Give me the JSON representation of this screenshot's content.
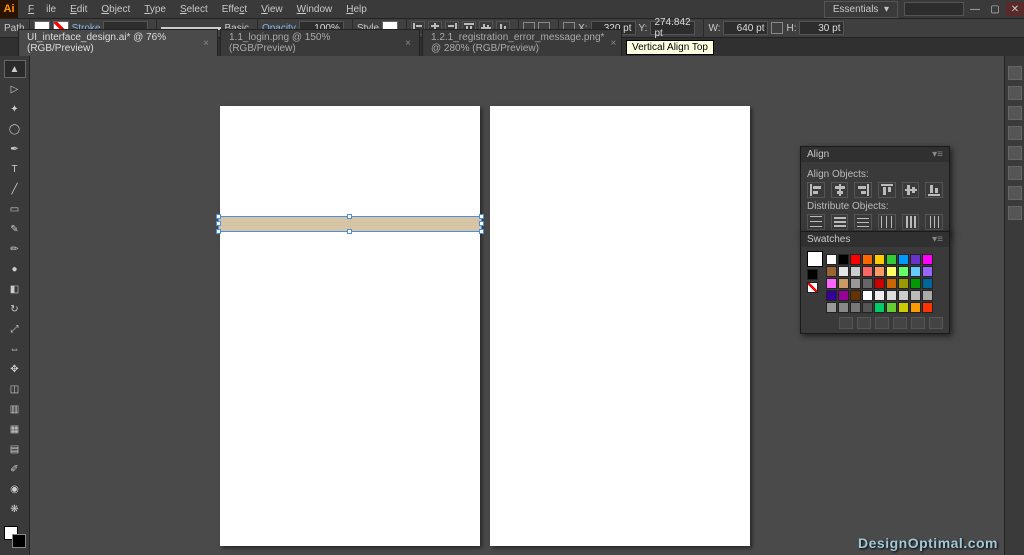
{
  "app": {
    "logo": "Ai",
    "workspace": "Essentials"
  },
  "menu": [
    "File",
    "Edit",
    "Object",
    "Type",
    "Select",
    "Effect",
    "View",
    "Window",
    "Help"
  ],
  "controlbar": {
    "selection": "Path",
    "stroke_label": "Stroke",
    "stroke_weight": "",
    "brush_label": "Basic",
    "opacity_label": "Opacity",
    "opacity_value": "100%",
    "style_label": "Style",
    "x_label": "X:",
    "x_value": "320 pt",
    "y_label": "Y:",
    "y_value": "274.842 pt",
    "w_label": "W:",
    "w_value": "640 pt",
    "h_label": "H:",
    "h_value": "30 pt"
  },
  "tabs": [
    {
      "label": "UI_interface_design.ai* @ 76% (RGB/Preview)",
      "active": true
    },
    {
      "label": "1.1_login.png @ 150% (RGB/Preview)",
      "active": false
    },
    {
      "label": "1.2.1_registration_error_message.png* @ 280% (RGB/Preview)",
      "active": false
    }
  ],
  "tooltip": "Vertical Align Top",
  "panels": {
    "align": {
      "title": "Align",
      "section1": "Align Objects:",
      "section2": "Distribute Objects:"
    },
    "swatches": {
      "title": "Swatches",
      "colors": [
        "#ffffff",
        "#000000",
        "#ff0000",
        "#ff6600",
        "#ffcc00",
        "#33cc33",
        "#0099ff",
        "#6633cc",
        "#ff00ff",
        "#996633",
        "#e6e6e6",
        "#cccccc",
        "#ff6666",
        "#ff9966",
        "#ffff66",
        "#66ff66",
        "#66ccff",
        "#9966ff",
        "#ff66ff",
        "#cc9966",
        "#999999",
        "#666666",
        "#cc0000",
        "#cc6600",
        "#999900",
        "#009900",
        "#006699",
        "#330099",
        "#990099",
        "#663300",
        "#ffffff",
        "#eeeeee",
        "#dddddd",
        "#cccccc",
        "#bbbbbb",
        "#aaaaaa",
        "#999999",
        "#888888",
        "#777777",
        "#555555",
        "#00cc66",
        "#66cc33",
        "#cccc00",
        "#ff9900",
        "#ff3300"
      ]
    }
  },
  "watermark": "DesignOptimal.com"
}
